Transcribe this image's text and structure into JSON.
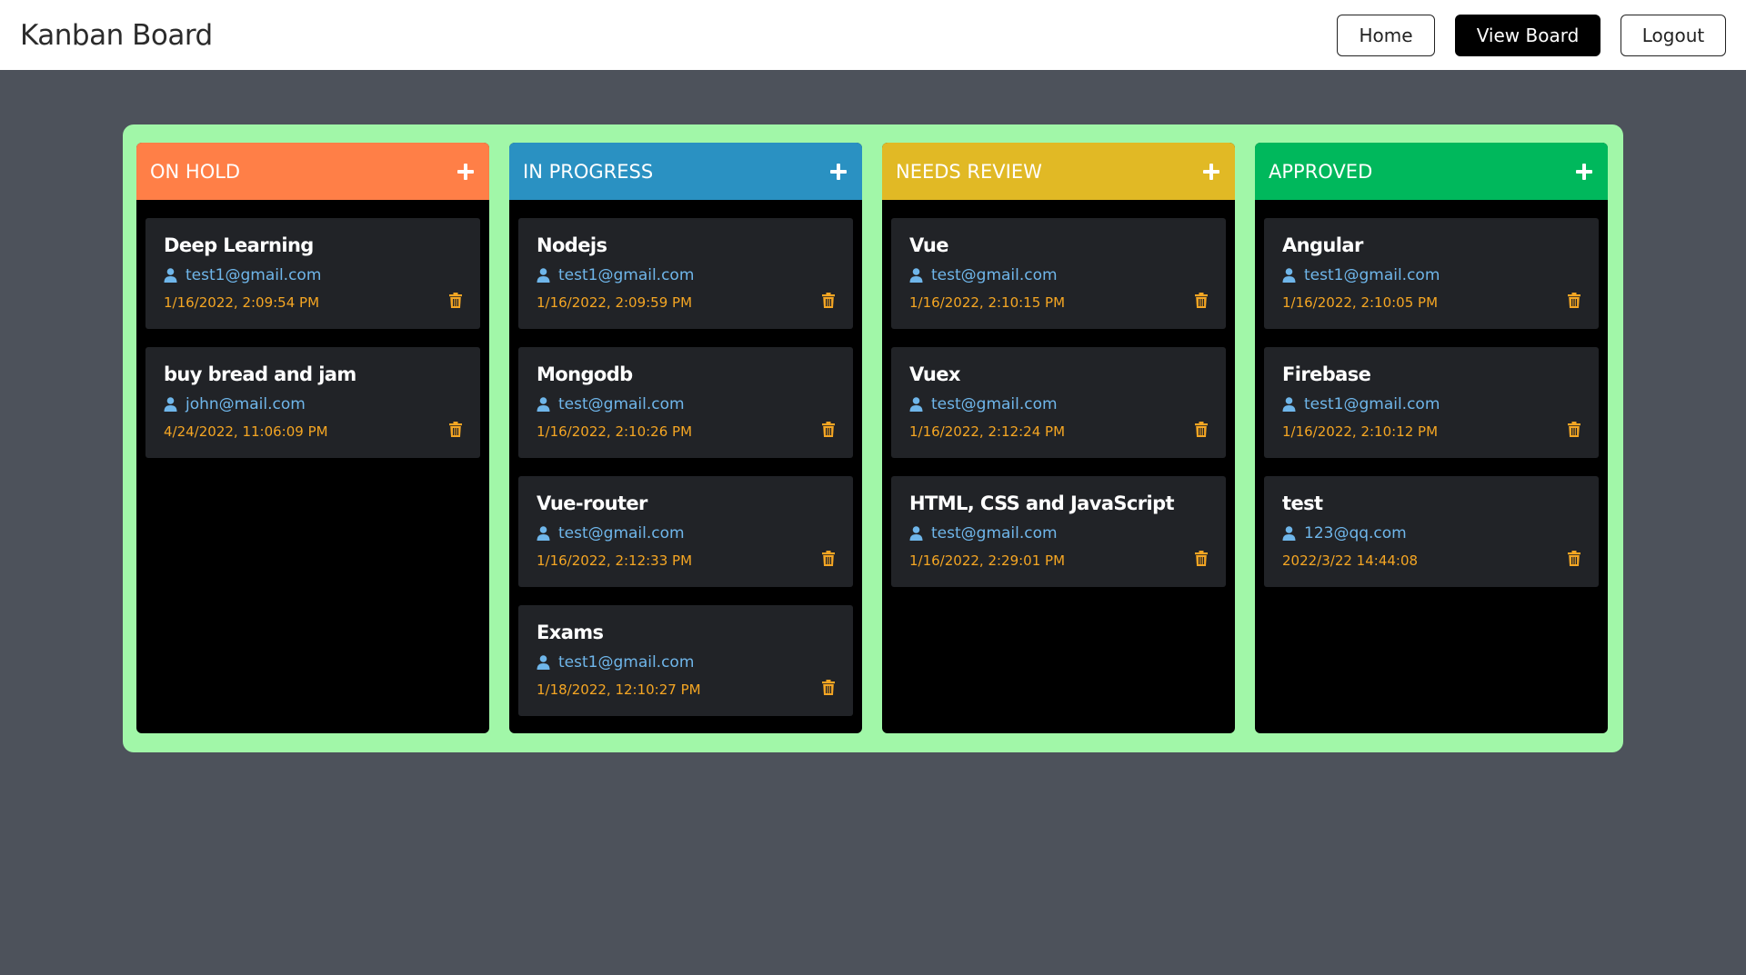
{
  "app": {
    "title": "Kanban Board",
    "nav": {
      "home": "Home",
      "view_board": "View Board",
      "logout": "Logout"
    }
  },
  "colors": {
    "board_bg": "#a1f7a8",
    "on_hold": "#ff7f47",
    "in_progress": "#2a91c2",
    "needs_review": "#e1b925",
    "approved": "#00b85c",
    "email": "#6fb6ea",
    "date": "#f5a623"
  },
  "columns": [
    {
      "title": "ON HOLD",
      "color": "#ff7f47",
      "cards": [
        {
          "title": "Deep Learning",
          "email": "test1@gmail.com",
          "date": "1/16/2022, 2:09:54 PM"
        },
        {
          "title": "buy bread and jam",
          "email": "john@mail.com",
          "date": "4/24/2022, 11:06:09 PM"
        }
      ]
    },
    {
      "title": "IN PROGRESS",
      "color": "#2a91c2",
      "cards": [
        {
          "title": "Nodejs",
          "email": "test1@gmail.com",
          "date": "1/16/2022, 2:09:59 PM"
        },
        {
          "title": "Mongodb",
          "email": "test@gmail.com",
          "date": "1/16/2022, 2:10:26 PM"
        },
        {
          "title": "Vue-router",
          "email": "test@gmail.com",
          "date": "1/16/2022, 2:12:33 PM"
        },
        {
          "title": "Exams",
          "email": "test1@gmail.com",
          "date": "1/18/2022, 12:10:27 PM"
        }
      ]
    },
    {
      "title": "NEEDS REVIEW",
      "color": "#e1b925",
      "cards": [
        {
          "title": "Vue",
          "email": "test@gmail.com",
          "date": "1/16/2022, 2:10:15 PM"
        },
        {
          "title": "Vuex",
          "email": "test@gmail.com",
          "date": "1/16/2022, 2:12:24 PM"
        },
        {
          "title": "HTML, CSS and JavaScript",
          "email": "test@gmail.com",
          "date": "1/16/2022, 2:29:01 PM"
        }
      ]
    },
    {
      "title": "APPROVED",
      "color": "#00b85c",
      "cards": [
        {
          "title": "Angular",
          "email": "test1@gmail.com",
          "date": "1/16/2022, 2:10:05 PM"
        },
        {
          "title": "Firebase",
          "email": "test1@gmail.com",
          "date": "1/16/2022, 2:10:12 PM"
        },
        {
          "title": "test",
          "email": "123@qq.com",
          "date": "2022/3/22 14:44:08"
        }
      ]
    }
  ]
}
